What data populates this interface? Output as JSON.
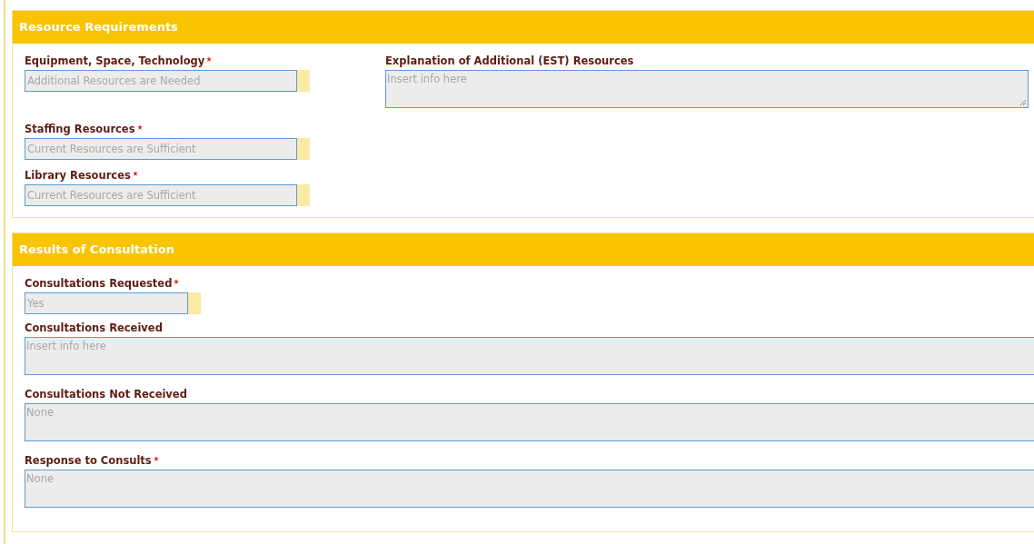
{
  "sections": [
    {
      "title": "Resource Requirements",
      "columns": [
        {
          "fields": [
            {
              "kind": "select",
              "label": "Equipment, Space, Technology",
              "required": true,
              "value": "Additional Resources are Needed"
            },
            {
              "kind": "select",
              "label": "Staffing Resources",
              "required": true,
              "value": "Current Resources are Sufficient"
            },
            {
              "kind": "select",
              "label": "Library Resources",
              "required": true,
              "value": "Current Resources are Sufficient"
            }
          ]
        },
        {
          "fields": [
            {
              "kind": "textarea",
              "label": "Explanation of Additional (EST) Resources",
              "required": false,
              "placeholder": "Insert info here",
              "resizable": true
            }
          ]
        }
      ]
    },
    {
      "title": "Results of Consultation",
      "fields": [
        {
          "kind": "select",
          "label": "Consultations Requested",
          "required": true,
          "value": "Yes"
        },
        {
          "kind": "textarea",
          "label": "Consultations Received",
          "required": false,
          "placeholder": "Insert info here"
        },
        {
          "kind": "textarea",
          "label": "Consultations Not Received",
          "required": false,
          "value": "None"
        },
        {
          "kind": "textarea",
          "label": "Response to Consults",
          "required": true,
          "value": "None"
        }
      ]
    }
  ]
}
